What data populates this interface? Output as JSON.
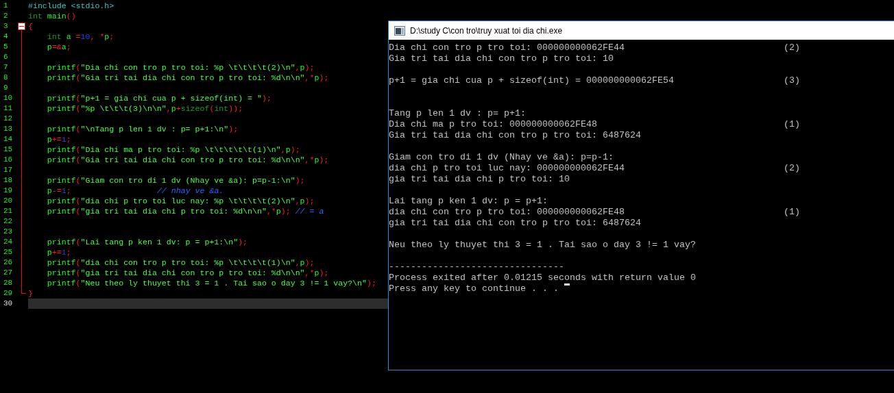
{
  "editor": {
    "lines": [
      {
        "number": "1",
        "current": false,
        "kind": "plain",
        "tokens": [
          {
            "kind": "pre",
            "text": "#include <stdio.h>"
          }
        ]
      },
      {
        "number": "2",
        "current": false,
        "kind": "plain",
        "tokens": [
          {
            "kind": "kw",
            "text": "int"
          },
          {
            "kind": "id",
            "text": " main"
          },
          {
            "kind": "op",
            "text": "()"
          }
        ]
      },
      {
        "number": "3",
        "current": false,
        "kind": "opener",
        "expanded": true,
        "tokens": [
          {
            "kind": "op",
            "text": "{"
          }
        ]
      },
      {
        "number": "4",
        "current": false,
        "kind": "body",
        "tokens": [
          {
            "kind": "kw",
            "text": "    int"
          },
          {
            "kind": "id",
            "text": " a "
          },
          {
            "kind": "op",
            "text": "="
          },
          {
            "kind": "num",
            "text": "10"
          },
          {
            "kind": "op",
            "text": ", *"
          },
          {
            "kind": "id",
            "text": "p"
          },
          {
            "kind": "op",
            "text": ";"
          }
        ]
      },
      {
        "number": "5",
        "current": false,
        "kind": "body",
        "tokens": [
          {
            "kind": "id",
            "text": "    p"
          },
          {
            "kind": "op",
            "text": "=&"
          },
          {
            "kind": "id",
            "text": "a"
          },
          {
            "kind": "op",
            "text": ";"
          }
        ]
      },
      {
        "number": "6",
        "current": false,
        "kind": "body"
      },
      {
        "number": "7",
        "current": false,
        "kind": "body",
        "tokens": [
          {
            "kind": "id",
            "text": "    printf"
          },
          {
            "kind": "op",
            "text": "("
          },
          {
            "kind": "str",
            "text": "\"Dia chi con tro p tro toi: %p \\t\\t\\t\\t(2)\\n\""
          },
          {
            "kind": "op",
            "text": ","
          },
          {
            "kind": "id",
            "text": "p"
          },
          {
            "kind": "op",
            "text": ");"
          }
        ]
      },
      {
        "number": "8",
        "current": false,
        "kind": "body",
        "tokens": [
          {
            "kind": "id",
            "text": "    printf"
          },
          {
            "kind": "op",
            "text": "("
          },
          {
            "kind": "str",
            "text": "\"Gia tri tai dia chi con tro p tro toi: %d\\n\\n\""
          },
          {
            "kind": "op",
            "text": ",*"
          },
          {
            "kind": "id",
            "text": "p"
          },
          {
            "kind": "op",
            "text": ");"
          }
        ]
      },
      {
        "number": "9",
        "current": false,
        "kind": "body"
      },
      {
        "number": "10",
        "current": false,
        "kind": "body",
        "tokens": [
          {
            "kind": "id",
            "text": "    printf"
          },
          {
            "kind": "op",
            "text": "("
          },
          {
            "kind": "str",
            "text": "\"p+1 = gia chi cua p + sizeof(int) = \""
          },
          {
            "kind": "op",
            "text": ");"
          }
        ]
      },
      {
        "number": "11",
        "current": false,
        "kind": "body",
        "tokens": [
          {
            "kind": "id",
            "text": "    printf"
          },
          {
            "kind": "op",
            "text": "("
          },
          {
            "kind": "str",
            "text": "\"%p \\t\\t\\t(3)\\n\\n\""
          },
          {
            "kind": "op",
            "text": ","
          },
          {
            "kind": "id",
            "text": "p"
          },
          {
            "kind": "op",
            "text": "+"
          },
          {
            "kind": "kw",
            "text": "sizeof"
          },
          {
            "kind": "op",
            "text": "("
          },
          {
            "kind": "kw",
            "text": "int"
          },
          {
            "kind": "op",
            "text": "));"
          }
        ]
      },
      {
        "number": "12",
        "current": false,
        "kind": "body"
      },
      {
        "number": "13",
        "current": false,
        "kind": "body",
        "tokens": [
          {
            "kind": "id",
            "text": "    printf"
          },
          {
            "kind": "op",
            "text": "("
          },
          {
            "kind": "str",
            "text": "\"\\nTang p len 1 dv : p= p+1:\\n\""
          },
          {
            "kind": "op",
            "text": ");"
          }
        ]
      },
      {
        "number": "14",
        "current": false,
        "kind": "body",
        "tokens": [
          {
            "kind": "id",
            "text": "    p"
          },
          {
            "kind": "op",
            "text": "+="
          },
          {
            "kind": "num",
            "text": "1"
          },
          {
            "kind": "op",
            "text": ";"
          }
        ]
      },
      {
        "number": "15",
        "current": false,
        "kind": "body",
        "tokens": [
          {
            "kind": "id",
            "text": "    printf"
          },
          {
            "kind": "op",
            "text": "("
          },
          {
            "kind": "str",
            "text": "\"Dia chi ma p tro toi: %p \\t\\t\\t\\t\\t(1)\\n\""
          },
          {
            "kind": "op",
            "text": ","
          },
          {
            "kind": "id",
            "text": "p"
          },
          {
            "kind": "op",
            "text": ");"
          }
        ]
      },
      {
        "number": "16",
        "current": false,
        "kind": "body",
        "tokens": [
          {
            "kind": "id",
            "text": "    printf"
          },
          {
            "kind": "op",
            "text": "("
          },
          {
            "kind": "str",
            "text": "\"Gia tri tai dia chi con tro p tro toi: %d\\n\\n\""
          },
          {
            "kind": "op",
            "text": ",*"
          },
          {
            "kind": "id",
            "text": "p"
          },
          {
            "kind": "op",
            "text": ");"
          }
        ]
      },
      {
        "number": "17",
        "current": false,
        "kind": "body"
      },
      {
        "number": "18",
        "current": false,
        "kind": "body",
        "tokens": [
          {
            "kind": "id",
            "text": "    printf"
          },
          {
            "kind": "op",
            "text": "("
          },
          {
            "kind": "str",
            "text": "\"Giam con tro di 1 dv (Nhay ve &a): p=p-1:\\n\""
          },
          {
            "kind": "op",
            "text": ");"
          }
        ]
      },
      {
        "number": "19",
        "current": false,
        "kind": "body",
        "tokens": [
          {
            "kind": "id",
            "text": "    p"
          },
          {
            "kind": "op",
            "text": "-="
          },
          {
            "kind": "num",
            "text": "1"
          },
          {
            "kind": "op",
            "text": ";"
          },
          {
            "kind": "comment",
            "text": "                  // nhay ve &a."
          }
        ]
      },
      {
        "number": "20",
        "current": false,
        "kind": "body",
        "tokens": [
          {
            "kind": "id",
            "text": "    printf"
          },
          {
            "kind": "op",
            "text": "("
          },
          {
            "kind": "str",
            "text": "\"dia chi p tro toi luc nay: %p \\t\\t\\t\\t(2)\\n\""
          },
          {
            "kind": "op",
            "text": ","
          },
          {
            "kind": "id",
            "text": "p"
          },
          {
            "kind": "op",
            "text": ");"
          }
        ]
      },
      {
        "number": "21",
        "current": false,
        "kind": "body",
        "tokens": [
          {
            "kind": "id",
            "text": "    printf"
          },
          {
            "kind": "op",
            "text": "("
          },
          {
            "kind": "str",
            "text": "\"gia tri tai dia chi p tro toi: %d\\n\\n\""
          },
          {
            "kind": "op",
            "text": ",*"
          },
          {
            "kind": "id",
            "text": "p"
          },
          {
            "kind": "op",
            "text": ");"
          },
          {
            "kind": "comment",
            "text": " // = a"
          }
        ]
      },
      {
        "number": "22",
        "current": false,
        "kind": "body"
      },
      {
        "number": "23",
        "current": false,
        "kind": "body"
      },
      {
        "number": "24",
        "current": false,
        "kind": "body",
        "tokens": [
          {
            "kind": "id",
            "text": "    printf"
          },
          {
            "kind": "op",
            "text": "("
          },
          {
            "kind": "str",
            "text": "\"Lai tang p ken 1 dv: p = p+1:\\n\""
          },
          {
            "kind": "op",
            "text": ");"
          }
        ]
      },
      {
        "number": "25",
        "current": false,
        "kind": "body",
        "tokens": [
          {
            "kind": "id",
            "text": "    p"
          },
          {
            "kind": "op",
            "text": "+="
          },
          {
            "kind": "num",
            "text": "1"
          },
          {
            "kind": "op",
            "text": ";"
          }
        ]
      },
      {
        "number": "26",
        "current": false,
        "kind": "body",
        "tokens": [
          {
            "kind": "id",
            "text": "    printf"
          },
          {
            "kind": "op",
            "text": "("
          },
          {
            "kind": "str",
            "text": "\"dia chi con tro p tro toi: %p \\t\\t\\t\\t(1)\\n\""
          },
          {
            "kind": "op",
            "text": ","
          },
          {
            "kind": "id",
            "text": "p"
          },
          {
            "kind": "op",
            "text": ");"
          }
        ]
      },
      {
        "number": "27",
        "current": false,
        "kind": "body",
        "tokens": [
          {
            "kind": "id",
            "text": "    printf"
          },
          {
            "kind": "op",
            "text": "("
          },
          {
            "kind": "str",
            "text": "\"gia tri tai dia chi con tro p tro toi: %d\\n\\n\""
          },
          {
            "kind": "op",
            "text": ",*"
          },
          {
            "kind": "id",
            "text": "p"
          },
          {
            "kind": "op",
            "text": ");"
          }
        ]
      },
      {
        "number": "28",
        "current": false,
        "kind": "body",
        "tokens": [
          {
            "kind": "id",
            "text": "    printf"
          },
          {
            "kind": "op",
            "text": "("
          },
          {
            "kind": "str",
            "text": "\"Neu theo ly thuyet thi 3 = 1 . Tai sao o day 3 != 1 vay?\\n\""
          },
          {
            "kind": "op",
            "text": ");"
          }
        ]
      },
      {
        "number": "29",
        "current": false,
        "kind": "closer",
        "tokens": [
          {
            "kind": "op",
            "text": "}"
          }
        ]
      },
      {
        "number": "30",
        "current": true,
        "kind": "plain"
      }
    ]
  },
  "console": {
    "title": "D:\\study C\\con tro\\truy xuat toi dia chi.exe",
    "lines": [
      {
        "kind": "text",
        "text": "Dia chi con tro p tro toi: 000000000062FE44",
        "note": "(2)"
      },
      {
        "kind": "text",
        "text": "Gia tri tai dia chi con tro p tro toi: 10"
      },
      {
        "kind": "blank"
      },
      {
        "kind": "text",
        "text": "p+1 = gia chi cua p + sizeof(int) = 000000000062FE54",
        "note": "(3)"
      },
      {
        "kind": "blank"
      },
      {
        "kind": "blank"
      },
      {
        "kind": "text",
        "text": "Tang p len 1 dv : p= p+1:"
      },
      {
        "kind": "text",
        "text": "Dia chi ma p tro toi: 000000000062FE48",
        "note": "(1)"
      },
      {
        "kind": "text",
        "text": "Gia tri tai dia chi con tro p tro toi: 6487624"
      },
      {
        "kind": "blank"
      },
      {
        "kind": "text",
        "text": "Giam con tro di 1 dv (Nhay ve &a): p=p-1:"
      },
      {
        "kind": "text",
        "text": "dia chi p tro toi luc nay: 000000000062FE44",
        "note": "(2)"
      },
      {
        "kind": "text",
        "text": "gia tri tai dia chi p tro toi: 10"
      },
      {
        "kind": "blank"
      },
      {
        "kind": "text",
        "text": "Lai tang p ken 1 dv: p = p+1:"
      },
      {
        "kind": "text",
        "text": "dia chi con tro p tro toi: 000000000062FE48",
        "note": "(1)"
      },
      {
        "kind": "text",
        "text": "gia tri tai dia chi con tro p tro toi: 6487624"
      },
      {
        "kind": "blank"
      },
      {
        "kind": "text",
        "text": "Neu theo ly thuyet thi 3 = 1 . Tai sao o day 3 != 1 vay?"
      },
      {
        "kind": "blank"
      },
      {
        "kind": "text",
        "text": "--------------------------------"
      },
      {
        "kind": "text",
        "text": "Process exited after 0.01215 seconds with return value 0"
      },
      {
        "kind": "prompt",
        "text": "Press any key to continue . . . "
      }
    ]
  }
}
